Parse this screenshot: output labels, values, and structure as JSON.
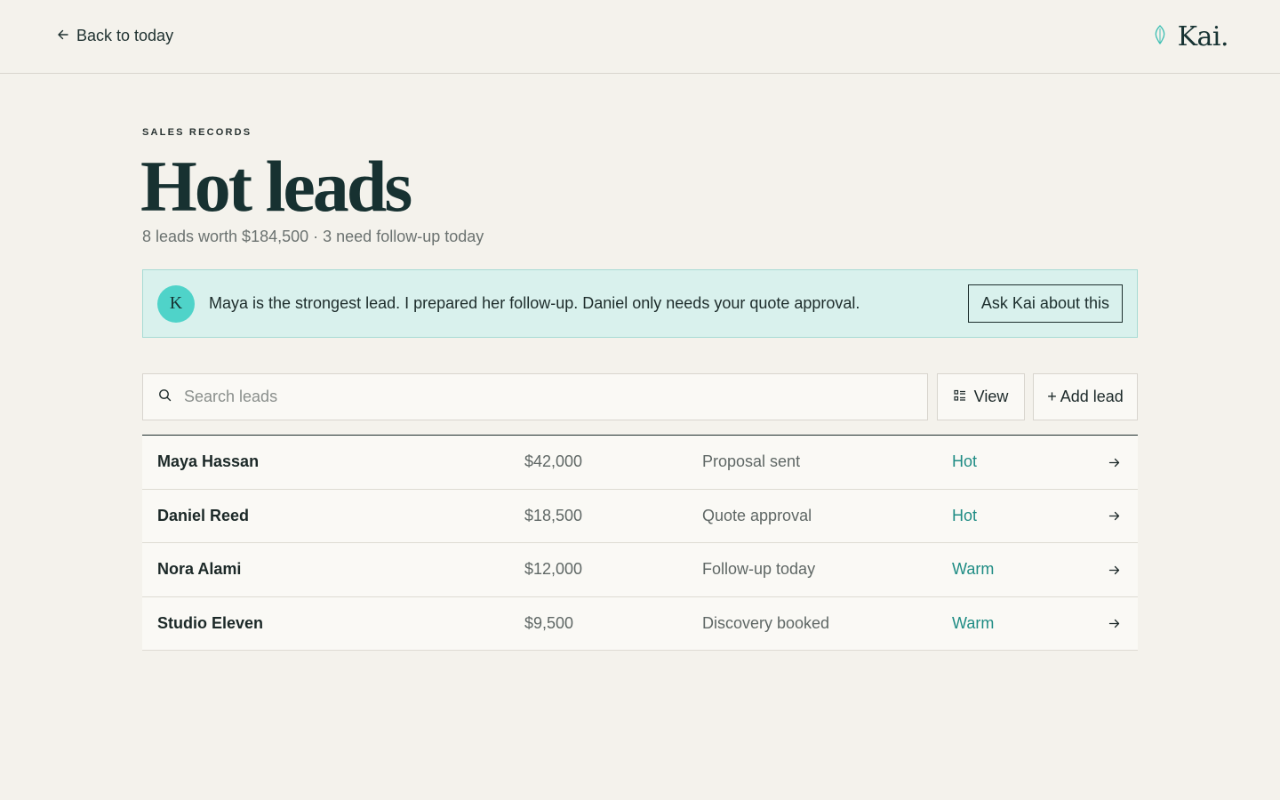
{
  "topbar": {
    "back_label": "Back to today",
    "brand_name": "Kai."
  },
  "header": {
    "eyebrow": "SALES RECORDS",
    "title": "Hot leads",
    "subtitle": "8 leads worth $184,500 · 3 need follow-up today"
  },
  "banner": {
    "avatar_letter": "K",
    "message": "Maya is the strongest lead. I prepared her follow-up. Daniel only needs your quote approval.",
    "action_label": "Ask Kai about this"
  },
  "toolbar": {
    "search_placeholder": "Search leads",
    "view_label": "View",
    "add_label": "+ Add lead"
  },
  "leads": [
    {
      "name": "Maya Hassan",
      "value": "$42,000",
      "stage": "Proposal sent",
      "status": "Hot"
    },
    {
      "name": "Daniel Reed",
      "value": "$18,500",
      "stage": "Quote approval",
      "status": "Hot"
    },
    {
      "name": "Nora Alami",
      "value": "$12,000",
      "stage": "Follow-up today",
      "status": "Warm"
    },
    {
      "name": "Studio Eleven",
      "value": "$9,500",
      "stage": "Discovery booked",
      "status": "Warm"
    }
  ],
  "colors": {
    "background": "#f4f2ec",
    "accent": "#1f8c84",
    "banner_bg": "#d9f1ed",
    "avatar": "#4fd3c9"
  },
  "icons": {
    "back": "arrow-left-icon",
    "brand": "leaf-icon",
    "search": "search-icon",
    "view": "list-view-icon",
    "row_open": "arrow-right-icon"
  }
}
